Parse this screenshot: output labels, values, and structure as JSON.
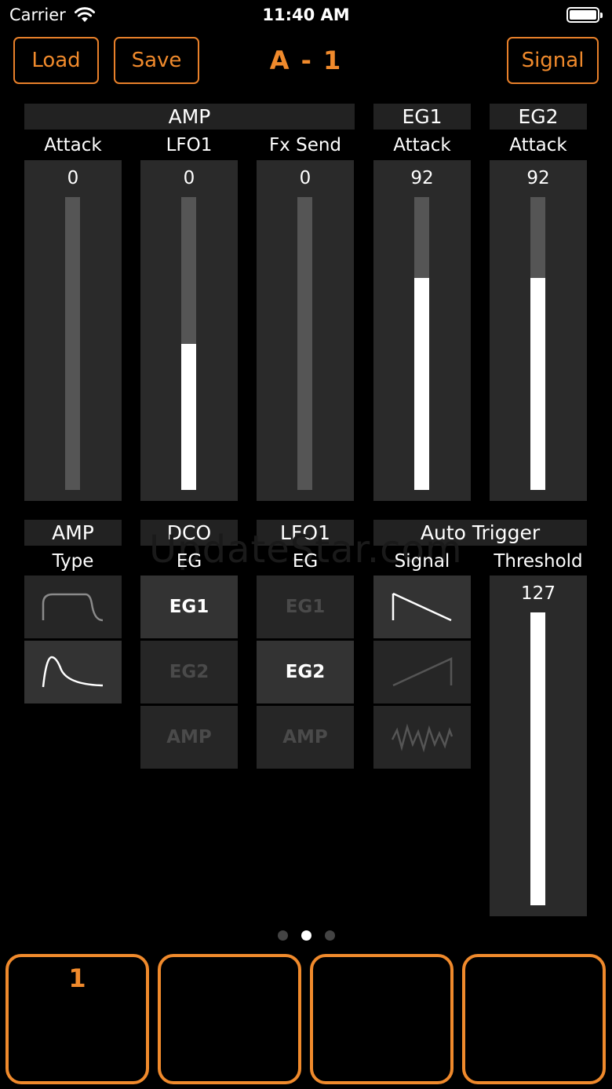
{
  "status_bar": {
    "carrier": "Carrier",
    "time": "11:40 AM"
  },
  "header": {
    "load": "Load",
    "save": "Save",
    "title": "A - 1",
    "signal": "Signal"
  },
  "amp_group": "AMP",
  "eg1_group": "EG1",
  "eg2_group": "EG2",
  "sliders": [
    {
      "label": "Attack",
      "value": "0",
      "level": 0
    },
    {
      "label": "LFO1",
      "value": "0",
      "level": 0.5
    },
    {
      "label": "Fx Send",
      "value": "0",
      "level": 0
    },
    {
      "label": "Attack",
      "value": "92",
      "level": 0.725
    },
    {
      "label": "Attack",
      "value": "92",
      "level": 0.725
    }
  ],
  "lower": {
    "amp_type": {
      "group": "AMP",
      "label": "Type"
    },
    "dco_eg": {
      "group": "DCO",
      "label": "EG",
      "options": [
        "EG1",
        "EG2",
        "AMP"
      ],
      "selected": "EG1"
    },
    "lfo1_eg": {
      "group": "LFO1",
      "label": "EG",
      "options": [
        "EG1",
        "EG2",
        "AMP"
      ],
      "selected": "EG2"
    },
    "auto_trigger": {
      "group": "Auto Trigger",
      "signal_label": "Signal",
      "threshold_label": "Threshold",
      "threshold_value": "127",
      "threshold_level": 1
    }
  },
  "watermark": "UpdateStar.com",
  "page_dots": {
    "count": 3,
    "active": 2
  },
  "pads": [
    "1",
    "",
    "",
    ""
  ],
  "colors": {
    "accent": "#f08a2c",
    "panel": "#2a2a2a",
    "background": "#000000"
  }
}
